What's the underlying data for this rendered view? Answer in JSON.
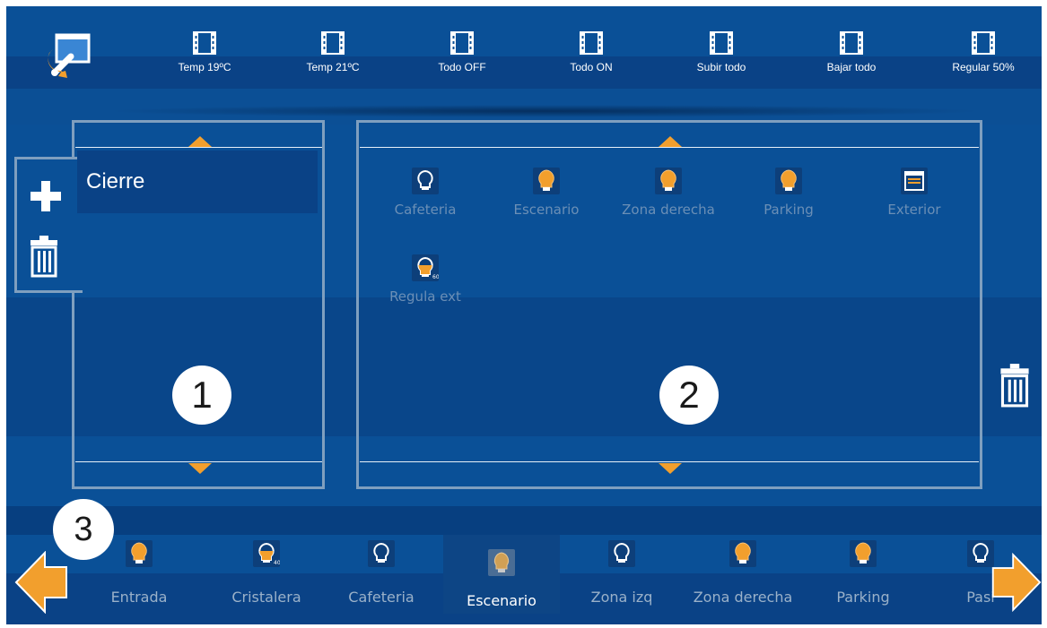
{
  "top_bar": {
    "logo_icon": "settings-wrench-icon",
    "scenes": [
      {
        "label": "Temp 19ºC",
        "icon": "film-icon"
      },
      {
        "label": "Temp 21ºC",
        "icon": "film-icon"
      },
      {
        "label": "Todo OFF",
        "icon": "film-icon"
      },
      {
        "label": "Todo ON",
        "icon": "film-icon"
      },
      {
        "label": "Subir todo",
        "icon": "film-icon"
      },
      {
        "label": "Bajar todo",
        "icon": "film-icon"
      },
      {
        "label": "Regular 50%",
        "icon": "film-icon"
      }
    ]
  },
  "left_panel": {
    "add_icon": "plus-icon",
    "delete_icon": "trash-icon",
    "items": [
      {
        "label": "Cierre"
      }
    ],
    "badge": "1"
  },
  "right_panel": {
    "badge": "2",
    "devices": [
      {
        "label": "Cafeteria",
        "icon": "bulb-off-icon"
      },
      {
        "label": "Escenario",
        "icon": "bulb-on-icon"
      },
      {
        "label": "Zona derecha",
        "icon": "bulb-on-icon"
      },
      {
        "label": "Parking",
        "icon": "bulb-on-icon"
      },
      {
        "label": "Exterior",
        "icon": "blind-icon"
      },
      {
        "label": "Regula ext",
        "icon": "dimmer-bulb-icon",
        "level": "60"
      }
    ],
    "delete_icon": "trash-icon"
  },
  "bottom_bar": {
    "badge": "3",
    "left_arrow_icon": "arrow-left-icon",
    "right_arrow_icon": "arrow-right-icon",
    "devices": [
      {
        "label": "Entrada",
        "icon": "bulb-on-icon"
      },
      {
        "label": "Cristalera",
        "icon": "dimmer-bulb-icon",
        "level": "40"
      },
      {
        "label": "Cafeteria",
        "icon": "bulb-off-icon"
      },
      {
        "label": "Escenario",
        "icon": "bulb-selected-icon",
        "selected": true
      },
      {
        "label": "Zona izq",
        "icon": "bulb-off-icon"
      },
      {
        "label": "Zona derecha",
        "icon": "bulb-on-icon"
      },
      {
        "label": "Parking",
        "icon": "bulb-on-icon"
      },
      {
        "label": "Pasi",
        "icon": "bulb-off-icon"
      }
    ]
  },
  "colors": {
    "background": "#0a5097",
    "dark_band": "#0a4286",
    "accent_orange": "#f29f2d",
    "frame": "#7f9fbf",
    "muted_label": "#6b8fb6"
  }
}
